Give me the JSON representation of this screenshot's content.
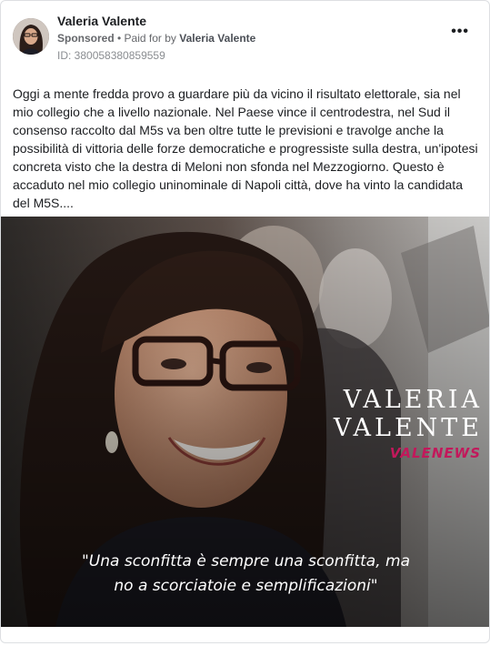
{
  "post": {
    "page_name": "Valeria Valente",
    "sponsored_label": "Sponsored",
    "paid_prefix": "• Paid for by",
    "payer": "Valeria Valente",
    "ad_id": "ID: 380058380859559",
    "more_icon": "more-horizontal-icon",
    "text": "Oggi a mente fredda provo a guardare più da vicino il risultato elettorale, sia nel mio collegio che a livello nazionale. Nel Paese vince il centrodestra, nel Sud il consenso raccolto dal M5s va ben oltre tutte le previsioni e travolge anche la possibilità di vittoria delle forze democratiche e progressiste sulla destra, un'ipotesi concreta visto che la destra di Meloni non sfonda nel Mezzogiorno. Questo è accaduto nel mio collegio uninominale di Napoli città, dove ha vinto la candidata del M5S...."
  },
  "creative": {
    "brand_line1": "VALERIA",
    "brand_line2": "VALENTE",
    "brand_sub": "VALENEWS",
    "quote_line1": "\"Una sconfitta è sempre una sconfitta, ma",
    "quote_line2": "no a scorciatoie e semplificazioni\""
  },
  "colors": {
    "accent": "#c2185b",
    "name_text": "#1c1e21",
    "meta_text": "#65676b"
  }
}
